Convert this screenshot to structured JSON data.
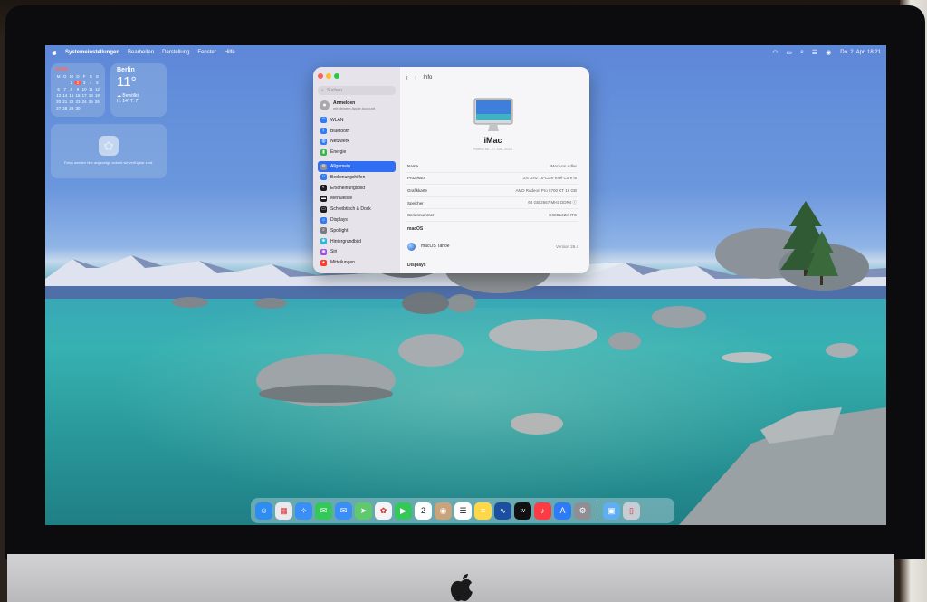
{
  "menubar": {
    "app_name": "Systemeinstellungen",
    "items": [
      "Bearbeiten",
      "Darstellung",
      "Fenster",
      "Hilfe"
    ],
    "clock": "Do. 2. Apr.  18:21"
  },
  "widgets": {
    "calendar": {
      "month": "APRIL",
      "weekdays": [
        "M",
        "D",
        "M",
        "D",
        "F",
        "S",
        "S"
      ],
      "days": [
        "",
        "",
        "1",
        "2",
        "3",
        "4",
        "5",
        "6",
        "7",
        "8",
        "9",
        "10",
        "11",
        "12",
        "13",
        "14",
        "15",
        "16",
        "17",
        "18",
        "19",
        "20",
        "21",
        "22",
        "23",
        "24",
        "25",
        "26",
        "27",
        "28",
        "29",
        "30",
        "",
        "",
        ""
      ],
      "today": "2"
    },
    "weather": {
      "city": "Berlin",
      "temp": "11°",
      "condition": "Bewölkt",
      "high_low": "H: 14° T: 7°"
    },
    "photos": {
      "note": "Fotos werden hier angezeigt, sobald sie verfügbar sind."
    }
  },
  "settings": {
    "search_placeholder": "Suchen",
    "account_title": "Anmelden",
    "account_sub": "mit deinem Apple Account",
    "sidebar": [
      {
        "label": "WLAN",
        "color": "#2f7cf6",
        "glyph": "◠"
      },
      {
        "label": "Bluetooth",
        "color": "#2f7cf6",
        "glyph": "ᛒ"
      },
      {
        "label": "Netzwerk",
        "color": "#2f7cf6",
        "glyph": "◍"
      },
      {
        "label": "Energie",
        "color": "#39b54a",
        "glyph": "▮"
      },
      {
        "label": "Allgemein",
        "color": "#8e8e93",
        "glyph": "⚙",
        "selected": true
      },
      {
        "label": "Bedienungshilfen",
        "color": "#2f7cf6",
        "glyph": "☺"
      },
      {
        "label": "Erscheinungsbild",
        "color": "#1c1c1e",
        "glyph": "◐"
      },
      {
        "label": "Menüleiste",
        "color": "#1c1c1e",
        "glyph": "▬"
      },
      {
        "label": "Schreibtisch & Dock",
        "color": "#1c1c1e",
        "glyph": "▭"
      },
      {
        "label": "Displays",
        "color": "#2f7cf6",
        "glyph": "☼"
      },
      {
        "label": "Spotlight",
        "color": "#7a7a80",
        "glyph": "⌕"
      },
      {
        "label": "Hintergrundbild",
        "color": "#2fb5d8",
        "glyph": "❀"
      },
      {
        "label": "Siri",
        "color": "#9b4de0",
        "glyph": "◉"
      },
      {
        "label": "Mitteilungen",
        "color": "#ff3b30",
        "glyph": "●"
      }
    ],
    "page_title": "Info",
    "model": "iMac",
    "model_sub": "Retina 5K, 27 Zoll, 2020",
    "rows": [
      {
        "key": "Name",
        "value": "iMac von Adler"
      },
      {
        "key": "Prozessor",
        "value": "3,6 GHz 10-Core Intel Core i9"
      },
      {
        "key": "Grafikkarte",
        "value": "AMD Radeon Pro 5700 XT 16 GB"
      },
      {
        "key": "Speicher",
        "value": "64 GB 2667 MHz DDR4"
      },
      {
        "key": "Seriennummer",
        "value": "C02DL2ZJHTC"
      }
    ],
    "os_section": "macOS",
    "os_name": "macOS Tahoe",
    "os_version": "Version 26.4",
    "displays_section": "Displays"
  },
  "dock": [
    {
      "name": "finder",
      "color": "#2f8cf0",
      "glyph": "☺"
    },
    {
      "name": "launchpad",
      "color": "#e9e9ee",
      "glyph": "▦"
    },
    {
      "name": "safari",
      "color": "#3a8ef5",
      "glyph": "✧"
    },
    {
      "name": "messages",
      "color": "#34c759",
      "glyph": "✉"
    },
    {
      "name": "mail",
      "color": "#3a8ef5",
      "glyph": "✉"
    },
    {
      "name": "maps",
      "color": "#5fc96d",
      "glyph": "➤"
    },
    {
      "name": "photos",
      "color": "#f4f4f6",
      "glyph": "✿"
    },
    {
      "name": "facetime",
      "color": "#34c759",
      "glyph": "▶"
    },
    {
      "name": "calendar",
      "color": "#ffffff",
      "glyph": "2"
    },
    {
      "name": "contacts",
      "color": "#c9a47a",
      "glyph": "◉"
    },
    {
      "name": "reminders",
      "color": "#ffffff",
      "glyph": "☰"
    },
    {
      "name": "notes",
      "color": "#ffd84a",
      "glyph": "≡"
    },
    {
      "name": "freeform",
      "color": "#1d4fa0",
      "glyph": "∿"
    },
    {
      "name": "tv",
      "color": "#111111",
      "glyph": "tv"
    },
    {
      "name": "music",
      "color": "#fc3c44",
      "glyph": "♪"
    },
    {
      "name": "app-store",
      "color": "#2d7cf6",
      "glyph": "A"
    },
    {
      "name": "system-settings",
      "color": "#8e8e93",
      "glyph": "⚙"
    },
    {
      "name": "downloads",
      "color": "#5eaef0",
      "glyph": "▣",
      "after_sep": true
    },
    {
      "name": "trash",
      "color": "#c7cdd3",
      "glyph": "▯"
    }
  ]
}
